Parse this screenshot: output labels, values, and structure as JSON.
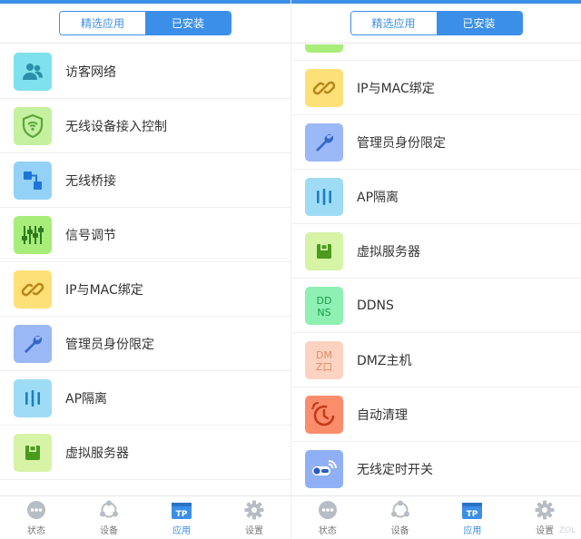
{
  "header": {
    "tabs": [
      "精选应用",
      "已安装"
    ],
    "active_index": 1
  },
  "left_list": [
    {
      "label": "访客网络",
      "icon": "guest-network-icon",
      "bg": "#7fe0ee"
    },
    {
      "label": "无线设备接入控制",
      "icon": "wireless-access-control-icon",
      "bg": "#c4f0a0"
    },
    {
      "label": "无线桥接",
      "icon": "wireless-bridge-icon",
      "bg": "#93d2f6"
    },
    {
      "label": "信号调节",
      "icon": "signal-adjust-icon",
      "bg": "#a8ec7a"
    },
    {
      "label": "IP与MAC绑定",
      "icon": "ip-mac-bind-icon",
      "bg": "#fde178"
    },
    {
      "label": "管理员身份限定",
      "icon": "admin-limit-icon",
      "bg": "#9bb8f7"
    },
    {
      "label": "AP隔离",
      "icon": "ap-isolation-icon",
      "bg": "#9edcf6"
    },
    {
      "label": "虚拟服务器",
      "icon": "virtual-server-icon",
      "bg": "#d6f3a6"
    }
  ],
  "right_list": [
    {
      "label": "",
      "icon": "partial-item-icon",
      "bg": "#a8ec7a"
    },
    {
      "label": "IP与MAC绑定",
      "icon": "ip-mac-bind-icon",
      "bg": "#fde178"
    },
    {
      "label": "管理员身份限定",
      "icon": "admin-limit-icon",
      "bg": "#9bb8f7"
    },
    {
      "label": "AP隔离",
      "icon": "ap-isolation-icon",
      "bg": "#9edcf6"
    },
    {
      "label": "虚拟服务器",
      "icon": "virtual-server-icon",
      "bg": "#d6f3a6"
    },
    {
      "label": "DDNS",
      "icon": "ddns-icon",
      "bg": "#8ef0b2"
    },
    {
      "label": "DMZ主机",
      "icon": "dmz-host-icon",
      "bg": "#fcd3c0"
    },
    {
      "label": "自动清理",
      "icon": "auto-clean-icon",
      "bg": "#fb8d6c"
    },
    {
      "label": "无线定时开关",
      "icon": "wireless-timer-icon",
      "bg": "#8fb0f6"
    }
  ],
  "tabbar": [
    {
      "label": "状态",
      "icon": "status-icon"
    },
    {
      "label": "设备",
      "icon": "devices-icon"
    },
    {
      "label": "应用",
      "icon": "apps-icon",
      "badge": "TP"
    },
    {
      "label": "设置",
      "icon": "settings-icon"
    }
  ],
  "tabbar_active_index": 2,
  "icon_text": {
    "ddns_top": "DD",
    "ddns_bottom": "NS",
    "dmz_top": "DM",
    "dmz_bottom": "Z口"
  },
  "watermark": "ZOL",
  "colors": {
    "accent": "#3c8fe8",
    "text": "#333333",
    "tab_inactive": "#9aa1a9"
  }
}
